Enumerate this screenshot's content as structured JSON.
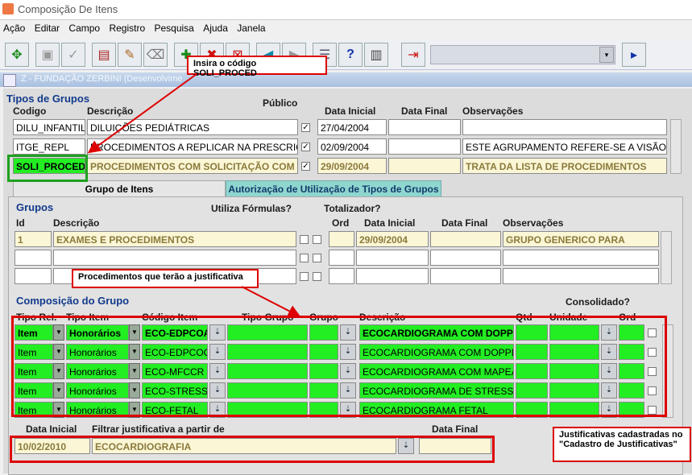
{
  "window": {
    "title": "Composição De Itens"
  },
  "menu": [
    "Ação",
    "Editar",
    "Campo",
    "Registro",
    "Pesquisa",
    "Ajuda",
    "Janela"
  ],
  "inner_title": "Z - FUNDAÇÃO ZERBINI (Desenvolvime",
  "tipos": {
    "header": "Tipos de Grupos",
    "col_codigo": "Codigo",
    "col_descricao": "Descrição",
    "col_publico": "Público",
    "col_data_inicial": "Data Inicial",
    "col_data_final": "Data Final",
    "col_observacoes": "Observações",
    "rows": [
      {
        "codigo": "DILU_INFANTIL",
        "descricao": "DILUIÇÕES PEDIÁTRICAS",
        "publico": "✓",
        "data_inicial": "27/04/2004",
        "data_final": "",
        "obs": ""
      },
      {
        "codigo": "ITGE_REPL",
        "descricao": "PROCEDIMENTOS A REPLICAR NA PRESCRIÇÃ",
        "publico": "✓",
        "data_inicial": "02/09/2004",
        "data_final": "",
        "obs": "ESTE AGRUPAMENTO REFERE-SE A VISÃO"
      },
      {
        "codigo": "SOLI_PROCED",
        "descricao": "PROCEDIMENTOS COM SOLICITAÇÃO COM",
        "publico": "✓",
        "data_inicial": "29/09/2004",
        "data_final": "",
        "obs": "TRATA DA LISTA DE PROCEDIMENTOS"
      }
    ]
  },
  "tabs": {
    "tab1": "Grupo de Itens",
    "tab2": "Autorização de Utilização de Tipos de Grupos"
  },
  "grupos": {
    "header": "Grupos",
    "col_id": "Id",
    "col_descricao": "Descrição",
    "col_formulas": "Utiliza Fórmulas?",
    "col_totalizador": "Totalizador?",
    "col_ord": "Ord",
    "col_data_inicial": "Data Inicial",
    "col_data_final": "Data Final",
    "col_obs": "Observações",
    "row1": {
      "id": "1",
      "descricao": "EXAMES E PROCEDIMENTOS",
      "data_inicial": "29/09/2004",
      "obs": "GRUPO GENERICO PARA"
    }
  },
  "composicao": {
    "header": "Composição do Grupo",
    "consolidado": "Consolidado?",
    "col_tipo_rel": "Tipo Rel.",
    "col_tipo_item": "Tipo Item",
    "col_codigo_item": "Código Item",
    "col_tipo_grupo": "Tipo Grupo",
    "col_grupo": "Grupo",
    "col_descricao": "Descrição",
    "col_qtd": "Qtd",
    "col_unidade": "Unidade",
    "col_ord": "Ord",
    "rows": [
      {
        "tipo_rel": "Item",
        "tipo_item": "Honorários",
        "codigo": "ECO-EDPCOA",
        "descricao": "ECOCARDIOGRAMA COM DOPP"
      },
      {
        "tipo_rel": "Item",
        "tipo_item": "Honorários",
        "codigo": "ECO-EDPCOC",
        "descricao": "ECOCARDIOGRAMA COM DOPPLE"
      },
      {
        "tipo_rel": "Item",
        "tipo_item": "Honorários",
        "codigo": "ECO-MFCCR",
        "descricao": "ECOCARDIOGRAMA COM MAPEAM"
      },
      {
        "tipo_rel": "Item",
        "tipo_item": "Honorários",
        "codigo": "ECO-STRESS",
        "descricao": "ECOCARDIOGRAMA DE STRESS"
      },
      {
        "tipo_rel": "Item",
        "tipo_item": "Honorários",
        "codigo": "ECO-FETAL",
        "descricao": "ECOCARDIOGRAMA FETAL"
      }
    ]
  },
  "justificativa": {
    "col_data_inicial": "Data Inicial",
    "col_filtrar": "Filtrar justificativa a partir de",
    "col_data_final": "Data Final",
    "data_inicial": "10/02/2010",
    "filtro": "ECOCARDIOGRAFIA",
    "data_final": ""
  },
  "callouts": {
    "c1": "Insira o código SOLI_PROCED",
    "c2": "Procedimentos que terão a justificativa",
    "c3": "Justificativas cadastradas no \"Cadastro de Justificativas\""
  },
  "colors": {
    "highlight": "#22ee22",
    "annotation": "#dd0000",
    "header": "#123a8c"
  }
}
